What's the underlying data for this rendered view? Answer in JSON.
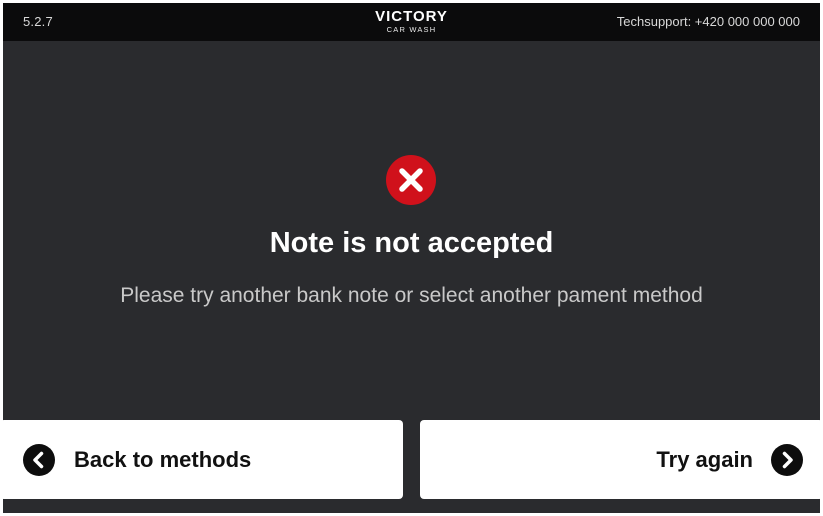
{
  "header": {
    "version": "5.2.7",
    "logo_main": "VICTORY",
    "logo_sub": "CAR WASH",
    "support": "Techsupport: +420 000 000 000"
  },
  "message": {
    "icon": "error-x-icon",
    "title": "Note is not accepted",
    "subtitle": "Please try another bank note or select another pament method"
  },
  "actions": {
    "back_label": "Back to methods",
    "back_icon": "chevron-left-circle-icon",
    "retry_label": "Try again",
    "retry_icon": "chevron-right-circle-icon"
  },
  "colors": {
    "background": "#2a2b2e",
    "topbar": "#0b0b0c",
    "error": "#d0111b",
    "button": "#ffffff"
  }
}
